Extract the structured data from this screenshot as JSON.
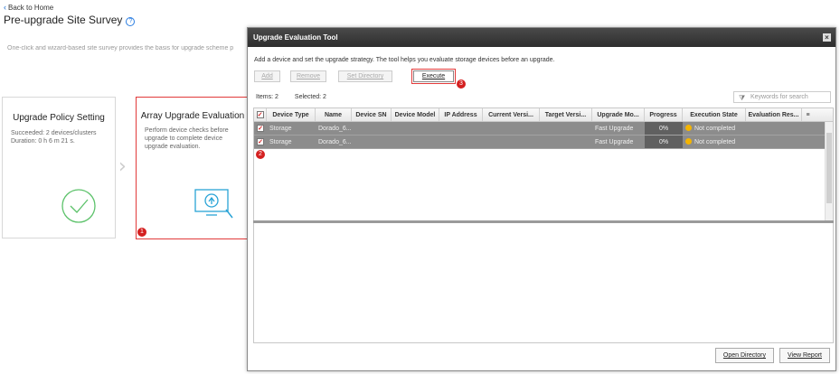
{
  "page": {
    "back_label": "Back to Home",
    "title": "Pre-upgrade Site Survey",
    "description": "One-click and wizard-based site survey provides the basis for upgrade scheme p"
  },
  "cards": {
    "policy": {
      "title": "Upgrade Policy Setting",
      "line1": "Succeeded: 2 devices/clusters",
      "line2": "Duration: 0 h 6 m 21 s."
    },
    "array": {
      "title": "Array Upgrade Evaluation",
      "desc": "Perform device checks before upgrade to complete device upgrade evaluation.",
      "badge": "1"
    }
  },
  "modal": {
    "title": "Upgrade Evaluation Tool",
    "close": "×",
    "description": "Add a device and set the upgrade strategy. The tool helps you evaluate storage devices before an upgrade.",
    "toolbar": {
      "add": "Add",
      "remove": "Remove",
      "set_directory": "Set Directory",
      "execute": "Execute",
      "execute_badge": "3"
    },
    "items_label": "Items: 2",
    "selected_label": "Selected: 2",
    "search_placeholder": "Keywords for search",
    "columns": [
      "Device Type",
      "Name",
      "Device SN",
      "Device Model",
      "IP Address",
      "Current Versi...",
      "Target Versi...",
      "Upgrade Mo...",
      "Progress",
      "Execution State",
      "Evaluation Res..."
    ],
    "rows": [
      {
        "type": "Storage",
        "name": "Dorado_6...",
        "sn": "",
        "model": "",
        "ip": "",
        "current": "",
        "target": "",
        "mode": "Fast Upgrade",
        "progress": "0%",
        "state": "Not completed",
        "result": ""
      },
      {
        "type": "Storage",
        "name": "Dorado_6...",
        "sn": "",
        "model": "",
        "ip": "",
        "current": "",
        "target": "",
        "mode": "Fast Upgrade",
        "progress": "0%",
        "state": "Not completed",
        "result": ""
      }
    ],
    "row_badge": "2",
    "open_directory": "Open Directory",
    "view_report": "View Report"
  },
  "colors": {
    "accent_blue": "#1a6fd1",
    "highlight_red": "#e23a3a",
    "row_grey": "#8c8c8c",
    "warning": "#f4b400"
  }
}
